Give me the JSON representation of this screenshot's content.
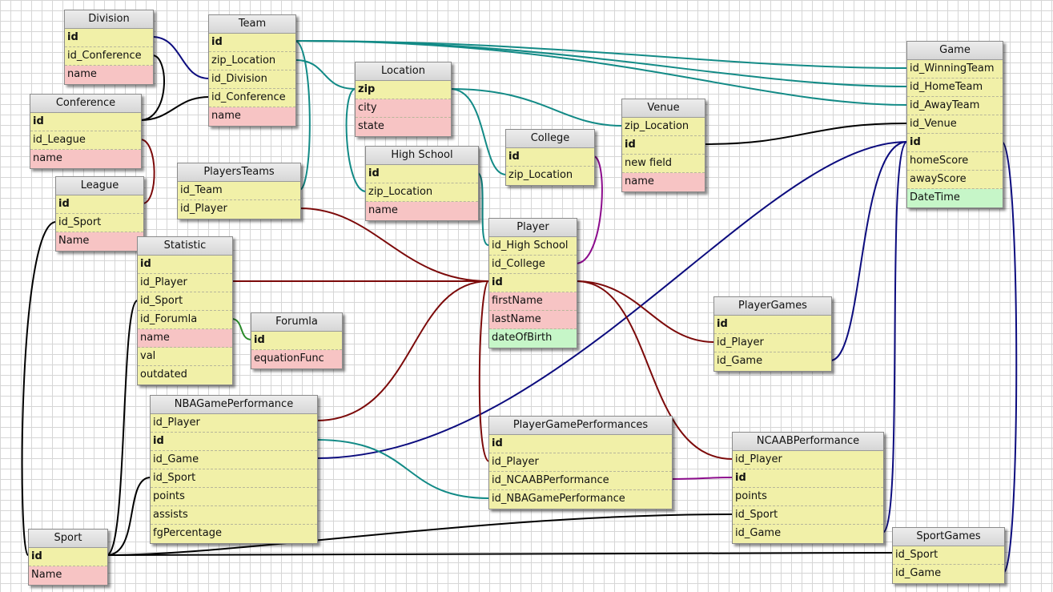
{
  "tables": {
    "division": {
      "name": "Division",
      "fields": [
        "id",
        "id_Conference",
        "name"
      ]
    },
    "team": {
      "name": "Team",
      "fields": [
        "id",
        "zip_Location",
        "id_Division",
        "id_Conference",
        "name"
      ]
    },
    "conference": {
      "name": "Conference",
      "fields": [
        "id",
        "id_League",
        "name"
      ]
    },
    "league": {
      "name": "League",
      "fields": [
        "id",
        "id_Sport",
        "Name"
      ]
    },
    "location": {
      "name": "Location",
      "fields": [
        "zip",
        "city",
        "state"
      ]
    },
    "highschool": {
      "name": "High School",
      "fields": [
        "id",
        "zip_Location",
        "name"
      ]
    },
    "college": {
      "name": "College",
      "fields": [
        "id",
        "zip_Location"
      ]
    },
    "venue": {
      "name": "Venue",
      "fields": [
        "zip_Location",
        "id",
        "new field",
        "name"
      ]
    },
    "game": {
      "name": "Game",
      "fields": [
        "id_WinningTeam",
        "id_HomeTeam",
        "id_AwayTeam",
        "id_Venue",
        "id",
        "homeScore",
        "awayScore",
        "DateTime"
      ]
    },
    "playersteams": {
      "name": "PlayersTeams",
      "fields": [
        "id_Team",
        "id_Player"
      ]
    },
    "statistic": {
      "name": "Statistic",
      "fields": [
        "id",
        "id_Player",
        "id_Sport",
        "id_Forumla",
        "name",
        "val",
        "outdated"
      ]
    },
    "forumla": {
      "name": "Forumla",
      "fields": [
        "id",
        "equationFunc"
      ]
    },
    "player": {
      "name": "Player",
      "fields": [
        "id_High School",
        "id_College",
        "id",
        "firstName",
        "lastName",
        "dateOfBirth"
      ]
    },
    "playergames": {
      "name": "PlayerGames",
      "fields": [
        "id",
        "id_Player",
        "id_Game"
      ]
    },
    "nbagameperformance": {
      "name": "NBAGamePerformance",
      "fields": [
        "id_Player",
        "id",
        "id_Game",
        "id_Sport",
        "points",
        "assists",
        "fgPercentage"
      ]
    },
    "playergameperformances": {
      "name": "PlayerGamePerformances",
      "fields": [
        "id",
        "id_Player",
        "id_NCAABPerformance",
        "id_NBAGamePerformance"
      ]
    },
    "ncaabperformance": {
      "name": "NCAABPerformance",
      "fields": [
        "id_Player",
        "id",
        "points",
        "id_Sport",
        "id_Game"
      ]
    },
    "sport": {
      "name": "Sport",
      "fields": [
        "id",
        "Name"
      ]
    },
    "sportgames": {
      "name": "SportGames",
      "fields": [
        "id_Sport",
        "id_Game"
      ]
    }
  },
  "colors": {
    "navy": "#0c0c7e",
    "teal": "#128a86",
    "maroon": "#7c0a0a",
    "black": "#000000",
    "green": "#2a8a2a",
    "purple": "#8c0c8c",
    "table_fill": "#f1f0a8",
    "required_field": "#f7c4c4",
    "optional_field": "#c6f6c8"
  }
}
